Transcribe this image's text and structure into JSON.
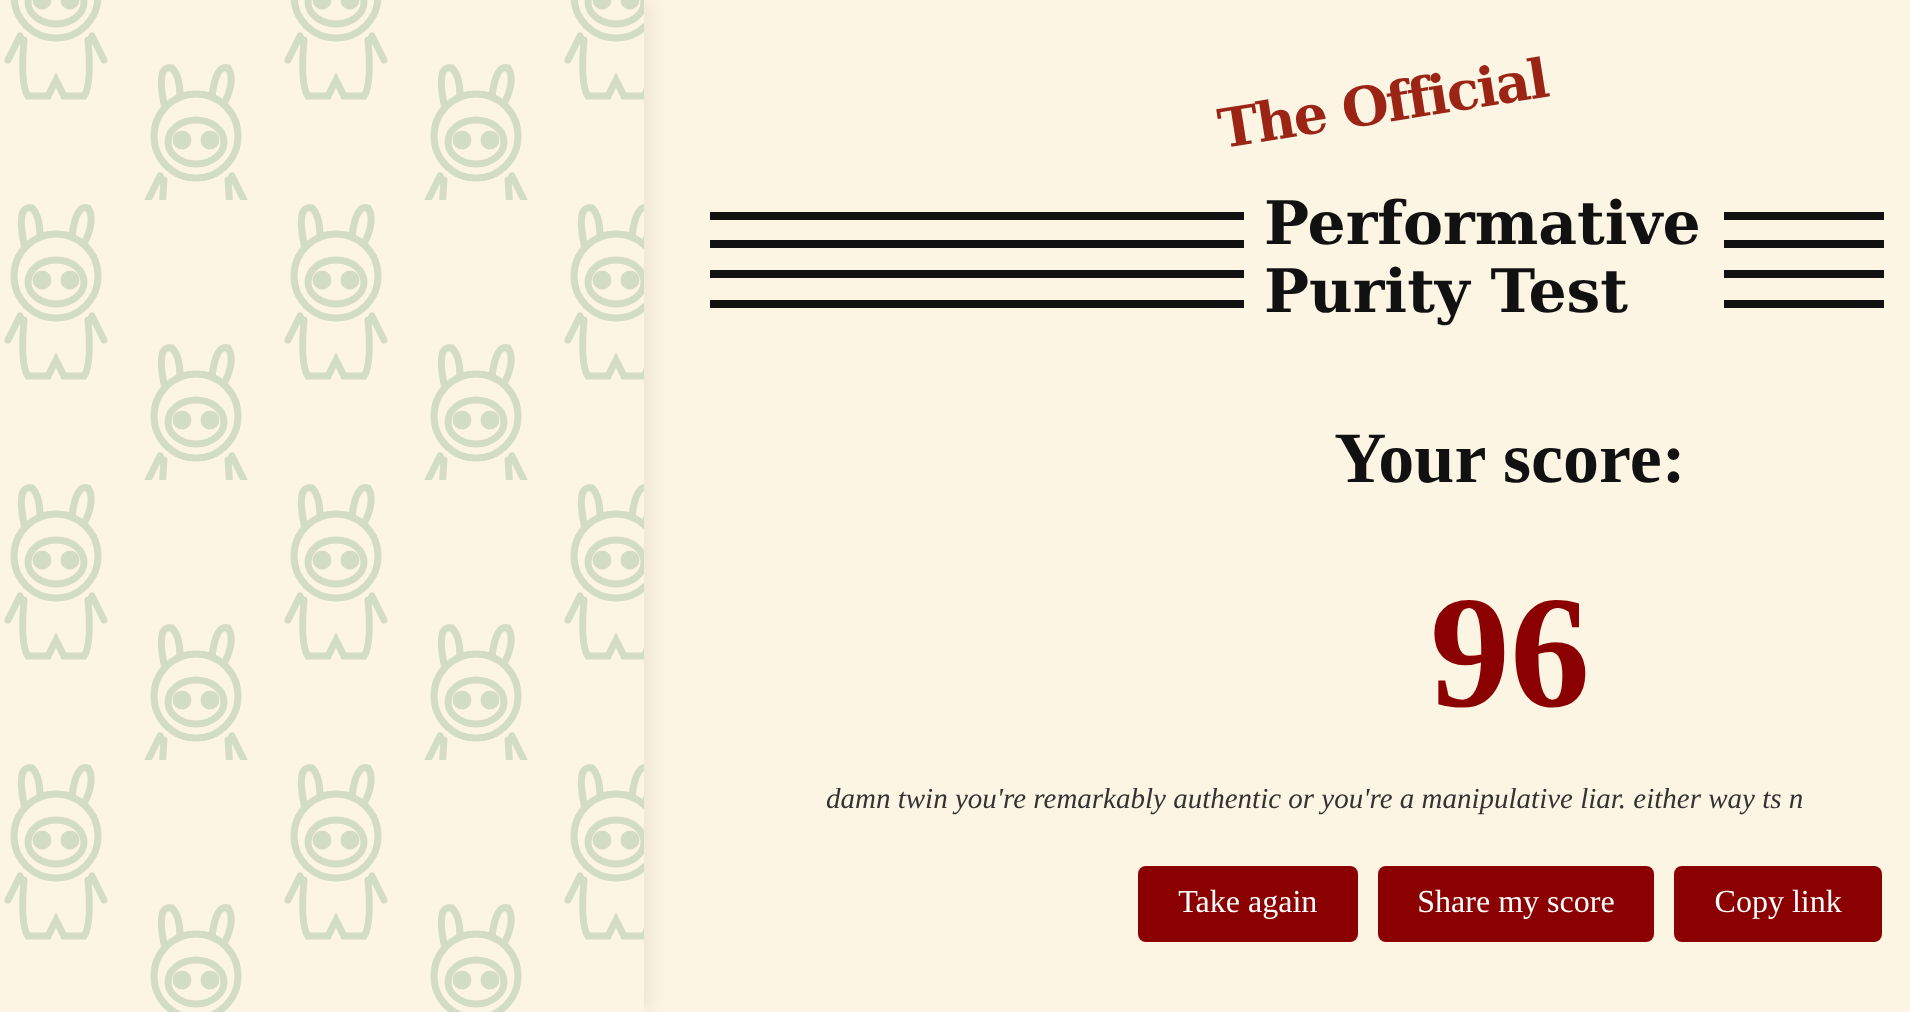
{
  "logo": {
    "tagline": "The Official",
    "title_lines": [
      "Performative",
      "Purity Test"
    ]
  },
  "result": {
    "heading": "Your score:",
    "score": "96",
    "message": "damn twin you're remarkably authentic or you're a manipulative liar. either way ts n"
  },
  "buttons": [
    {
      "label": "Take again"
    },
    {
      "label": "Share my score"
    },
    {
      "label": "Copy link"
    }
  ]
}
